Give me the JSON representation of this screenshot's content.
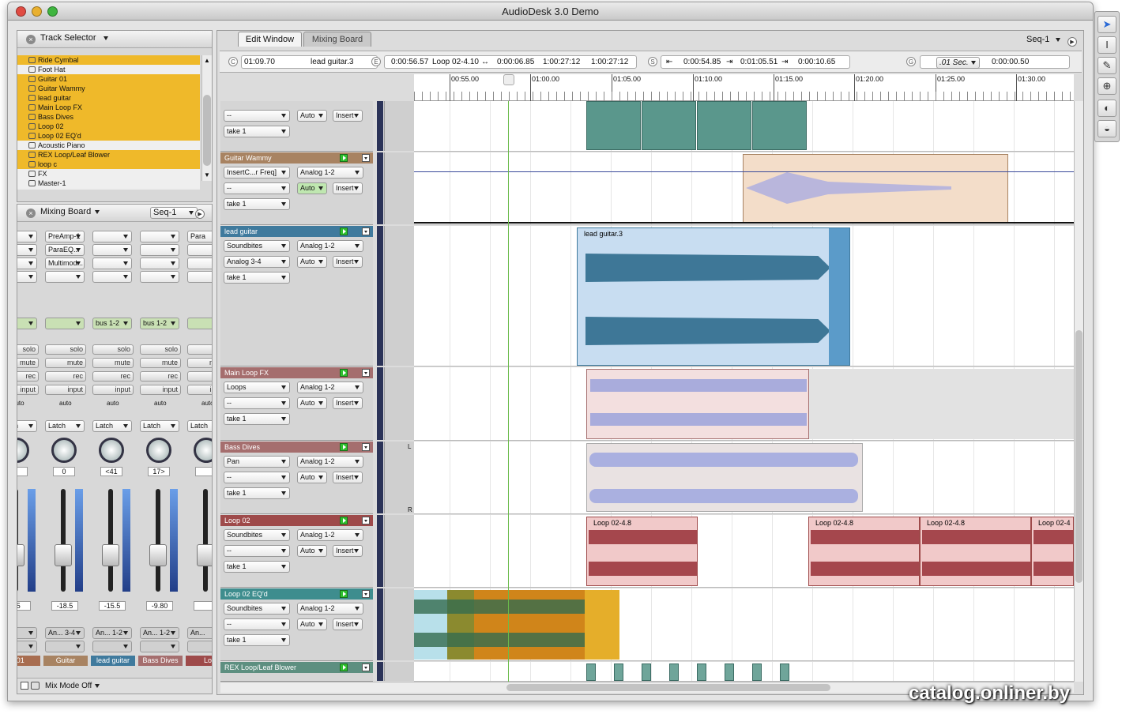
{
  "window": {
    "title": "AudioDesk 3.0 Demo"
  },
  "colors": {
    "selected_track": "#efb92a",
    "track_green": "#5d8f80",
    "track_tan": "#a88362",
    "track_blue": "#3f7a9d",
    "track_rose": "#a56e6e",
    "track_red": "#9e4a4a",
    "track_teal": "#3e8d8e",
    "clip_blue": "#c8ddf1",
    "clip_rose": "#f3dfdf"
  },
  "track_selector": {
    "title": "Track Selector",
    "items": [
      "Ride Cymbal",
      "Foot Hat",
      "Guitar 01",
      "Guitar Wammy",
      "lead guitar",
      "Main Loop FX",
      "Bass Dives",
      "Loop 02",
      "Loop 02 EQ'd",
      "Acoustic Piano",
      "REX Loop/Leaf Blower",
      "loop c",
      "FX",
      "Master-1"
    ]
  },
  "mixing_panel": {
    "title": "Mixing Board",
    "seq": "Seq-1",
    "inserts": [
      "PreAmp-1",
      "ParaEQ...",
      "Multimod...",
      "Para"
    ],
    "solo": "solo",
    "mute": "mute",
    "rec": "rec",
    "input": "input",
    "auto": "auto",
    "latch": "Latch",
    "bus": "bus 1-2",
    "pans": [
      "0",
      "<41",
      "17>"
    ],
    "levels": [
      ".5",
      "-18.5",
      "-15.5",
      "-9.80"
    ],
    "outs": [
      "An... 3-4",
      "An... 1-2",
      "An... 1-2",
      "An..."
    ],
    "names": [
      "r 01",
      "Guitar Wammy",
      "lead guitar",
      "Bass Dives",
      "Lo"
    ],
    "mix_mode": "Mix Mode Off",
    "scale": [
      "6",
      "0",
      "6",
      "12",
      "24",
      "48",
      "∞"
    ]
  },
  "tabs": {
    "edit": "Edit Window",
    "mix": "Mixing Board",
    "seq": "Seq-1"
  },
  "counters": {
    "cursor": "01:09.70",
    "track": "lead guitar.3",
    "e1": "0:00:56.57",
    "clip": "Loop 02-4.10",
    "arrow": "↔",
    "e2": "0:00:06.85",
    "e3": "1:00:27:12",
    "e4": "1:00:27:12",
    "s1": "0:00:54.85",
    "s2": "0:01:05.51",
    "s3": "0:00:10.65",
    "g_unit": ".01 Sec.",
    "g_val": "0:00:00.50",
    "c_label": "C",
    "e_label": "E",
    "s_label": "S",
    "g_label": "G"
  },
  "ruler": [
    "00:55.00",
    "01:00.00",
    "01:05.00",
    "01:10.00",
    "01:15.00",
    "01:20.00",
    "01:25.00",
    "01:30.00"
  ],
  "tracks": [
    {
      "name": "",
      "f1": "--",
      "f2": "Auto",
      "f3": "Insert",
      "take": "take 1"
    },
    {
      "name": "Guitar Wammy",
      "row1a": "InsertC...r Freq]",
      "row1b": "Analog 1-2",
      "f1": "--",
      "f2": "Auto",
      "f3": "Insert",
      "take": "take 1"
    },
    {
      "name": "lead guitar",
      "row1a": "Soundbites",
      "row1b": "Analog 1-2",
      "f1": "Analog 3-4",
      "f2": "Auto",
      "f3": "Insert",
      "take": "take 1",
      "clip": "lead guitar.3"
    },
    {
      "name": "Main Loop FX",
      "row1a": "Loops",
      "row1b": "Analog 1-2",
      "f1": "--",
      "f2": "Auto",
      "f3": "Insert",
      "take": "take 1"
    },
    {
      "name": "Bass Dives",
      "row1a": "Pan",
      "row1b": "Analog 1-2",
      "f1": "--",
      "f2": "Auto",
      "f3": "Insert",
      "take": "take 1",
      "l": "L",
      "r": "R"
    },
    {
      "name": "Loop 02",
      "row1a": "Soundbites",
      "row1b": "Analog 1-2",
      "f1": "--",
      "f2": "Auto",
      "f3": "Insert",
      "take": "take 1",
      "clips": [
        "Loop 02-4.8",
        "Loop 02-4.8",
        "Loop 02-4.8",
        "Loop 02-4"
      ]
    },
    {
      "name": "Loop 02 EQ'd",
      "row1a": "Soundbites",
      "row1b": "Analog 1-2",
      "f1": "--",
      "f2": "Auto",
      "f3": "Insert",
      "take": "take 1"
    },
    {
      "name": "REX Loop/Leaf Blower"
    }
  ],
  "watermark": "catalog.onliner.by"
}
